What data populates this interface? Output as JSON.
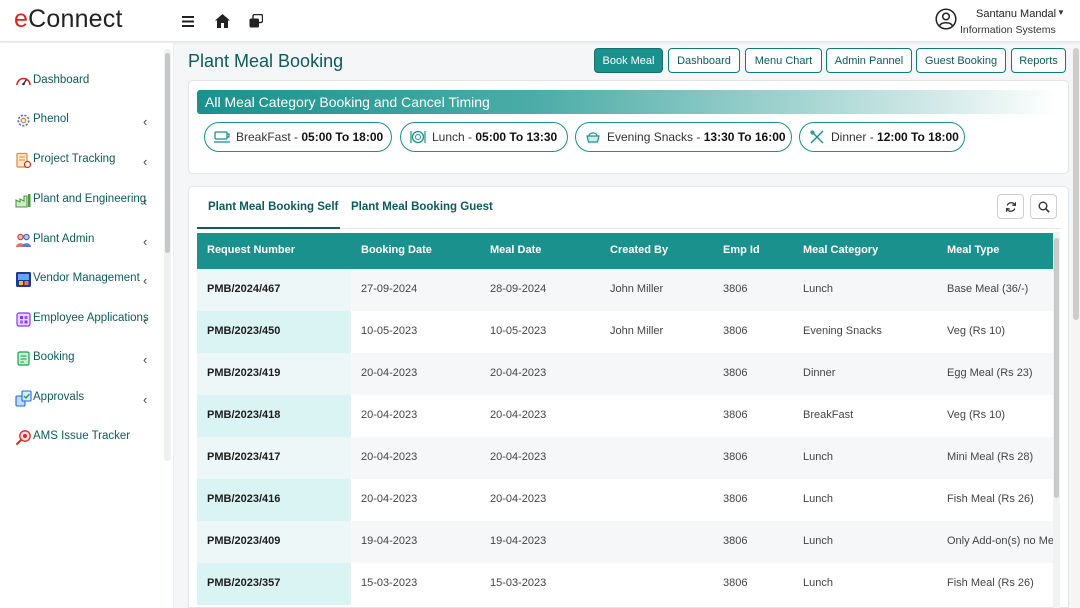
{
  "header": {
    "logo_e": "e",
    "logo_rest": "Connect",
    "user_name": "Santanu Mandal",
    "user_dept": "Information Systems",
    "caret": "▼"
  },
  "sidebar": {
    "items": [
      {
        "label": "Dashboard",
        "icon": "speedometer-icon",
        "chevron": false
      },
      {
        "label": "Phenol",
        "icon": "gear-icon",
        "chevron": true
      },
      {
        "label": "Project Tracking",
        "icon": "document-icon",
        "chevron": true
      },
      {
        "label": "Plant and Engineering",
        "icon": "factory-icon",
        "chevron": true
      },
      {
        "label": "Plant Admin",
        "icon": "users-icon",
        "chevron": true
      },
      {
        "label": "Vendor Management",
        "icon": "vendor-icon",
        "chevron": true
      },
      {
        "label": "Employee Applications",
        "icon": "app-icon",
        "chevron": true
      },
      {
        "label": "Booking",
        "icon": "booking-icon",
        "chevron": true
      },
      {
        "label": "Approvals",
        "icon": "approval-icon",
        "chevron": true
      },
      {
        "label": "AMS Issue Tracker",
        "icon": "tracker-icon",
        "chevron": false
      }
    ],
    "chevron_glyph": "‹"
  },
  "page": {
    "title": "Plant Meal Booking",
    "buttons": [
      "Book Meal",
      "Dashboard",
      "Menu Chart",
      "Admin Pannel",
      "Guest Booking",
      "Reports"
    ]
  },
  "timing": {
    "heading": "All Meal Category Booking and Cancel Timing",
    "pills": [
      {
        "name": "BreakFast",
        "sep": " - ",
        "time": "05:00 To 18:00",
        "icon": "breakfast-icon"
      },
      {
        "name": "Lunch",
        "sep": " - ",
        "time": "05:00 To 13:30",
        "icon": "lunch-icon"
      },
      {
        "name": "Evening Snacks",
        "sep": " - ",
        "time": "13:30 To 16:00",
        "icon": "snacks-icon"
      },
      {
        "name": "Dinner",
        "sep": " - ",
        "time": "12:00 To 18:00",
        "icon": "dinner-icon"
      }
    ]
  },
  "tabs": [
    "Plant Meal Booking Self",
    "Plant Meal Booking Guest"
  ],
  "table": {
    "headers": [
      "Request Number",
      "Booking Date",
      "Meal Date",
      "Created By",
      "Emp Id",
      "Meal Category",
      "Meal Type"
    ],
    "rows": [
      [
        "PMB/2024/467",
        "27-09-2024",
        "28-09-2024",
        "John Miller",
        "3806",
        "Lunch",
        "Base Meal (36/-)"
      ],
      [
        "PMB/2023/450",
        "10-05-2023",
        "10-05-2023",
        "John Miller",
        "3806",
        "Evening Snacks",
        "Veg (Rs 10)"
      ],
      [
        "PMB/2023/419",
        "20-04-2023",
        "20-04-2023",
        "",
        "3806",
        "Dinner",
        "Egg Meal (Rs 23)"
      ],
      [
        "PMB/2023/418",
        "20-04-2023",
        "20-04-2023",
        "",
        "3806",
        "BreakFast",
        "Veg (Rs 10)"
      ],
      [
        "PMB/2023/417",
        "20-04-2023",
        "20-04-2023",
        "",
        "3806",
        "Lunch",
        "Mini Meal (Rs 28)"
      ],
      [
        "PMB/2023/416",
        "20-04-2023",
        "20-04-2023",
        "",
        "3806",
        "Lunch",
        "Fish Meal (Rs 26)"
      ],
      [
        "PMB/2023/409",
        "19-04-2023",
        "19-04-2023",
        "",
        "3806",
        "Lunch",
        "Only Add-on(s) no Me"
      ],
      [
        "PMB/2023/357",
        "15-03-2023",
        "15-03-2023",
        "",
        "3806",
        "Lunch",
        "Fish Meal (Rs 26)"
      ]
    ]
  },
  "colors": {
    "accent": "#1a918d",
    "brand_red": "#d7261e",
    "text_teal": "#0e5a5c"
  }
}
